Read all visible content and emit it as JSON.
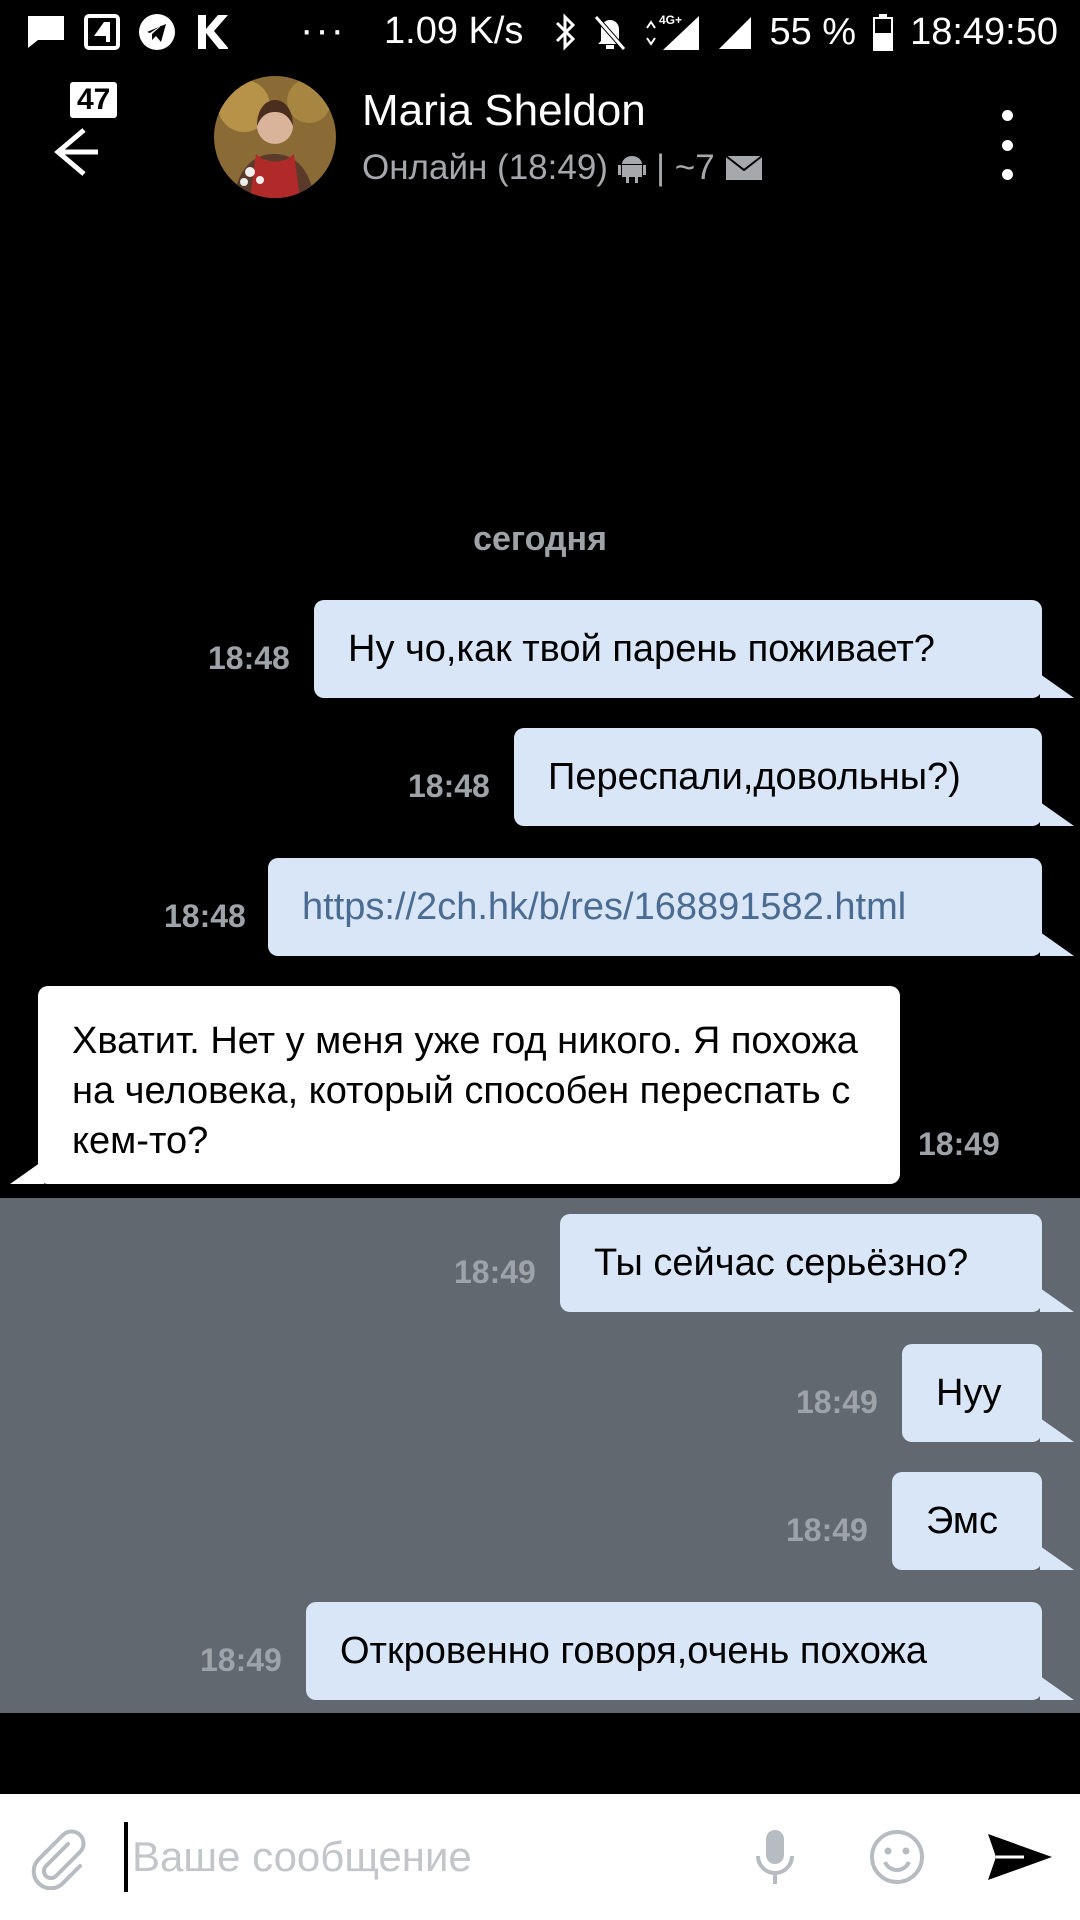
{
  "status_bar": {
    "net_speed": "1.09 K/s",
    "dots": "···",
    "network_type": "4G+",
    "battery": "55 %",
    "time": "18:49:50"
  },
  "header": {
    "unread_count": "47",
    "contact_name": "Maria Sheldon",
    "status_text": "Онлайн (18:49)",
    "extra": "| ~7"
  },
  "chat": {
    "date_separator": "сегодня",
    "messages": [
      {
        "text": "Ну чо,как твой парень поживает?",
        "time": "18:48",
        "direction": "out"
      },
      {
        "text": "Переспали,довольны?)",
        "time": "18:48",
        "direction": "out"
      },
      {
        "text": "https://2ch.hk/b/res/168891582.html",
        "time": "18:48",
        "direction": "out"
      },
      {
        "text": "Хватит. Нет у меня уже год никого. Я похожа на человека, который способен переспать с кем-то?",
        "time": "18:49",
        "direction": "in"
      },
      {
        "text": "Ты сейчас серьёзно?",
        "time": "18:49",
        "direction": "out"
      },
      {
        "text": "Нуу",
        "time": "18:49",
        "direction": "out"
      },
      {
        "text": "Эмс",
        "time": "18:49",
        "direction": "out"
      },
      {
        "text": "Откровенно говоря,очень похожа",
        "time": "18:49",
        "direction": "out"
      }
    ]
  },
  "composer": {
    "placeholder": "Ваше сообщение"
  },
  "colors": {
    "background": "#000000",
    "bubble_out": "#d8e6f7",
    "bubble_in": "#ffffff",
    "selection_highlight": "#616870",
    "timestamp": "#9ea3a9",
    "link": "#4b6c92"
  }
}
